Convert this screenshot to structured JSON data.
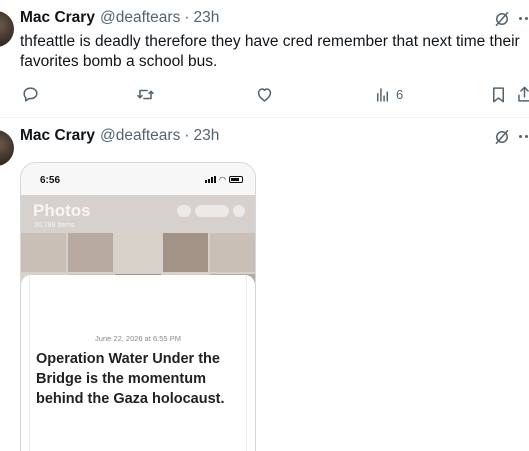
{
  "tweets": [
    {
      "author_name": "Mac Crary",
      "handle": "@deaftears",
      "separator": "·",
      "time": "23h",
      "text": "thfeattle is deadly therefore they have cred remember that next time their favorites bomb a school bus.",
      "stats": {
        "views": "6"
      }
    },
    {
      "author_name": "Mac Crary",
      "handle": "@deaftears",
      "separator": "·",
      "time": "23h",
      "media": {
        "status_time": "6:56",
        "photos_title": "Photos",
        "photos_subtitle": "20,789 Items",
        "note_date": "June 22, 2026 at 6:55 PM",
        "note_text": "Operation Water Under the Bridge is the momentum behind the Gaza holocaust."
      }
    }
  ],
  "icons": {
    "reply": "reply-icon",
    "retweet": "retweet-icon",
    "like": "heart-icon",
    "views": "views-icon",
    "bookmark": "bookmark-icon",
    "share": "share-icon",
    "grok": "grok-icon",
    "more": "more-icon"
  },
  "colors": {
    "text": "#0f1419",
    "secondary": "#536471",
    "border": "#cfd9de"
  }
}
